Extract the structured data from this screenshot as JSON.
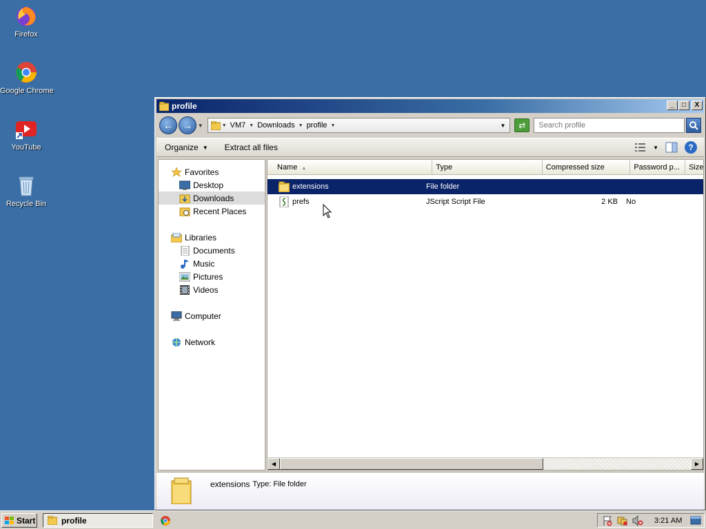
{
  "desktop": {
    "icons": [
      {
        "label": "Firefox"
      },
      {
        "label": "Google Chrome"
      },
      {
        "label": "YouTube"
      },
      {
        "label": "Recycle Bin"
      }
    ]
  },
  "window": {
    "title": "profile",
    "controls": {
      "minimize": "_",
      "maximize": "□",
      "close": "X"
    }
  },
  "address": {
    "crumbs": [
      "VM7",
      "Downloads",
      "profile"
    ],
    "search_placeholder": "Search profile"
  },
  "toolbar": {
    "organize": "Organize",
    "extract": "Extract all files",
    "help": "?"
  },
  "nav": {
    "favorites": "Favorites",
    "desktop": "Desktop",
    "downloads": "Downloads",
    "recent": "Recent Places",
    "libraries": "Libraries",
    "documents": "Documents",
    "music": "Music",
    "pictures": "Pictures",
    "videos": "Videos",
    "computer": "Computer",
    "network": "Network"
  },
  "columns": [
    "Name",
    "Type",
    "Compressed size",
    "Password p...",
    "Size"
  ],
  "files": [
    {
      "name": "extensions",
      "type": "File folder",
      "compressed": "",
      "password": "",
      "selected": true
    },
    {
      "name": "prefs",
      "type": "JScript Script File",
      "compressed": "2 KB",
      "password": "No",
      "selected": false
    }
  ],
  "details": {
    "name": "extensions",
    "type": "Type: File folder"
  },
  "taskbar": {
    "start": "Start",
    "window_label": "profile",
    "clock": "3:21 AM"
  },
  "colors": {
    "desktop_bg": "#3a6ea5",
    "selection": "#0a246a"
  }
}
